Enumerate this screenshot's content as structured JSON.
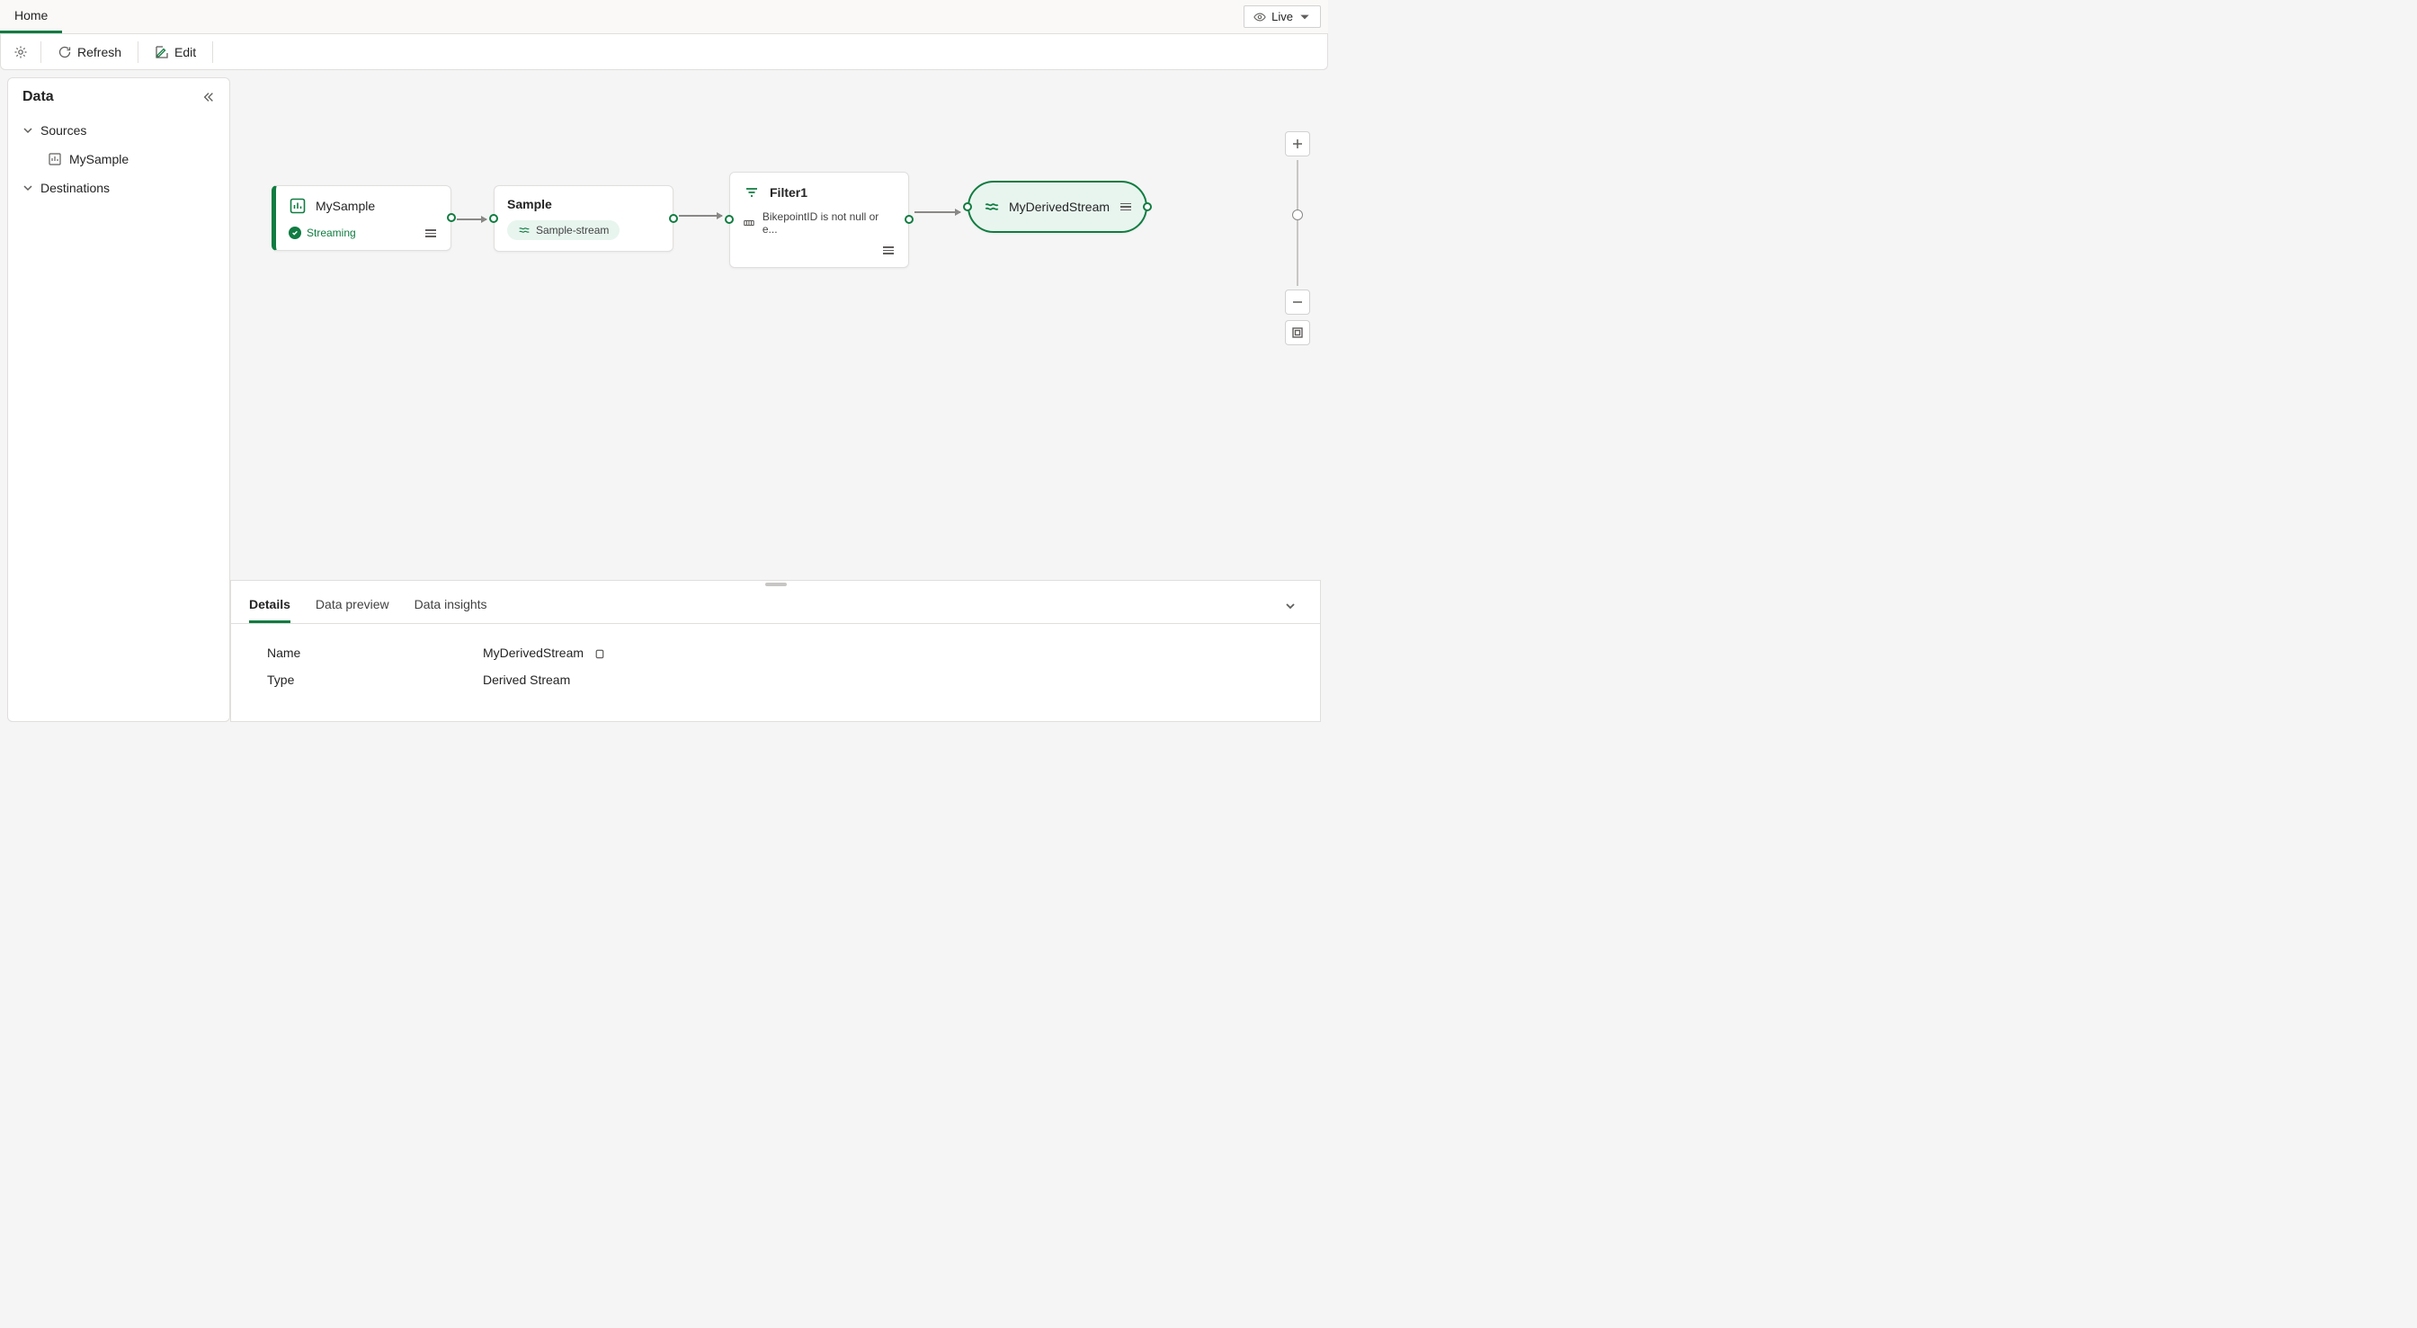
{
  "topTabs": {
    "home": "Home"
  },
  "liveButton": "Live",
  "toolbar": {
    "refresh": "Refresh",
    "edit": "Edit"
  },
  "sidebar": {
    "title": "Data",
    "sources": "Sources",
    "destinations": "Destinations",
    "items": {
      "mysample": "MySample"
    }
  },
  "nodes": {
    "source": {
      "title": "MySample",
      "status": "Streaming"
    },
    "sample": {
      "title": "Sample",
      "pill": "Sample-stream"
    },
    "filter": {
      "title": "Filter1",
      "expr": "BikepointID is not null or e..."
    },
    "derived": {
      "title": "MyDerivedStream"
    }
  },
  "bottomTabs": {
    "details": "Details",
    "preview": "Data preview",
    "insights": "Data insights"
  },
  "details": {
    "nameLabel": "Name",
    "nameValue": "MyDerivedStream",
    "typeLabel": "Type",
    "typeValue": "Derived Stream"
  }
}
